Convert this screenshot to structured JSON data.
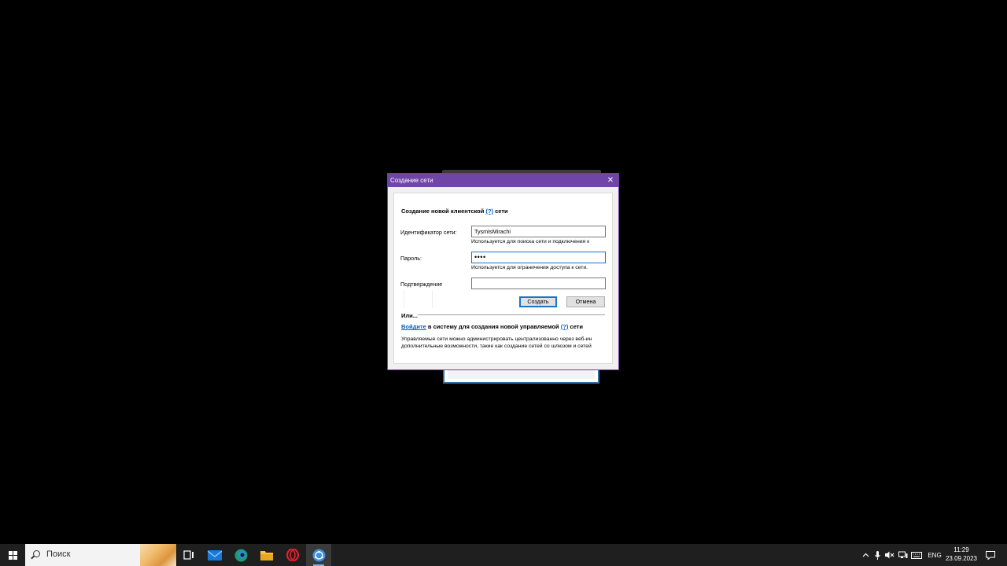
{
  "dialog": {
    "title": "Создание сети",
    "close_glyph": "✕",
    "heading_prefix": "Создание новой клиентской",
    "heading_help": "(?)",
    "heading_suffix": "сети",
    "network_id_label": "Идентификатор сети:",
    "network_id_value": "TysmIsMirachi",
    "network_id_hint": "Используется для поиска сети и подключения к",
    "password_label": "Пароль:",
    "password_value": "••••",
    "password_hint": "Используется для ограничения доступа к сети.",
    "confirm_label": "Подтверждение",
    "confirm_value": "",
    "create_button": "Создать",
    "cancel_button": "Отмена",
    "or_label": "Или...",
    "signin_link": "Войдите",
    "signin_text_mid": "в систему для создания новой управляемой",
    "signin_help": "(?)",
    "signin_text_end": "сети",
    "desc_line1": "Управляемые сети можно администрировать централизованно через веб-ин",
    "desc_line2": "дополнительные возможности, такие как создание сетей со шлюзом и сетей"
  },
  "taskbar": {
    "search_placeholder": "Поиск",
    "language": "ENG",
    "time": "11:29",
    "date": "23.09.2023",
    "icons": [
      "windows-start-icon",
      "search-icon",
      "task-view-icon",
      "mail-icon",
      "edge-icon",
      "file-explorer-icon",
      "opera-icon",
      "network-app-icon"
    ],
    "tray_icons": [
      "chevron-up-icon",
      "microphone-icon",
      "speaker-muted-icon",
      "network-icon",
      "keyboard-icon",
      "notification-icon"
    ]
  },
  "colors": {
    "titlebar": "#7045a8",
    "link": "#0060c0",
    "focus_border": "#1c73c8",
    "taskbar": "#1f1f1f"
  }
}
